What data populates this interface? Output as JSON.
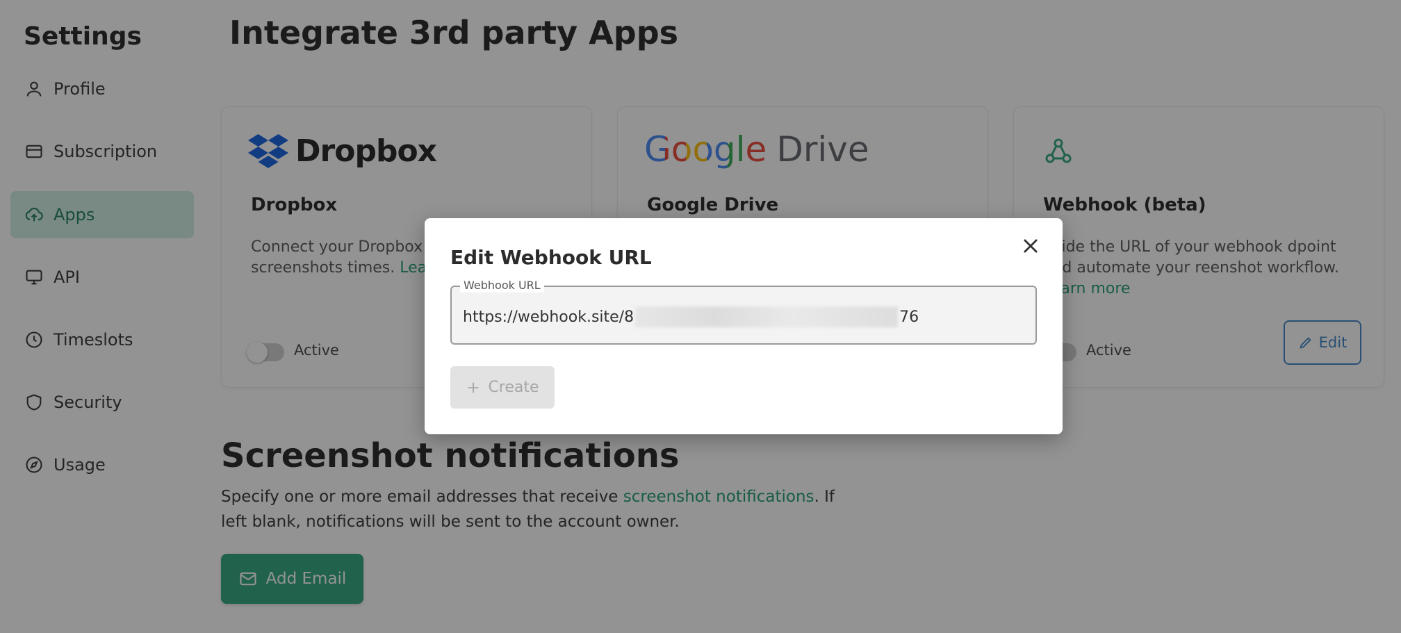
{
  "sidebar": {
    "title": "Settings",
    "items": [
      {
        "label": "Profile",
        "icon": "user-icon"
      },
      {
        "label": "Subscription",
        "icon": "credit-card-icon"
      },
      {
        "label": "Apps",
        "icon": "cloud-upload-icon",
        "active": true
      },
      {
        "label": "API",
        "icon": "monitor-icon"
      },
      {
        "label": "Timeslots",
        "icon": "clock-icon"
      },
      {
        "label": "Security",
        "icon": "shield-icon"
      },
      {
        "label": "Usage",
        "icon": "compass-icon"
      }
    ]
  },
  "main": {
    "title": "Integrate 3rd party Apps",
    "cards": [
      {
        "logo_text": "Dropbox",
        "name": "Dropbox",
        "desc": "Connect your Dropbox keep your screenshots times.",
        "link": "Learn more",
        "toggle_label": "Active"
      },
      {
        "logo_text_google": "Google",
        "logo_text_drive": "Drive",
        "name": "Google Drive"
      },
      {
        "name": "Webhook (beta)",
        "desc": "ovide the URL of your webhook dpoint and automate your reenshot workflow.",
        "link": "Learn more",
        "toggle_label": "Active",
        "edit_label": "Edit"
      }
    ],
    "notifications": {
      "title": "Screenshot notifications",
      "desc_before": "Specify one or more email addresses that receive ",
      "desc_link": "screenshot notifications",
      "desc_after": ". If left blank, notifications will be sent to the account owner.",
      "add_email_label": "Add Email"
    }
  },
  "modal": {
    "title": "Edit Webhook URL",
    "field_label": "Webhook URL",
    "value_start": "https://webhook.site/8",
    "value_end": "76",
    "create_label": "Create"
  },
  "colors": {
    "accent": "#2ea57e",
    "link": "#1d9a74",
    "edit_blue": "#3b82c4",
    "active_nav_bg": "#cfeee3"
  }
}
